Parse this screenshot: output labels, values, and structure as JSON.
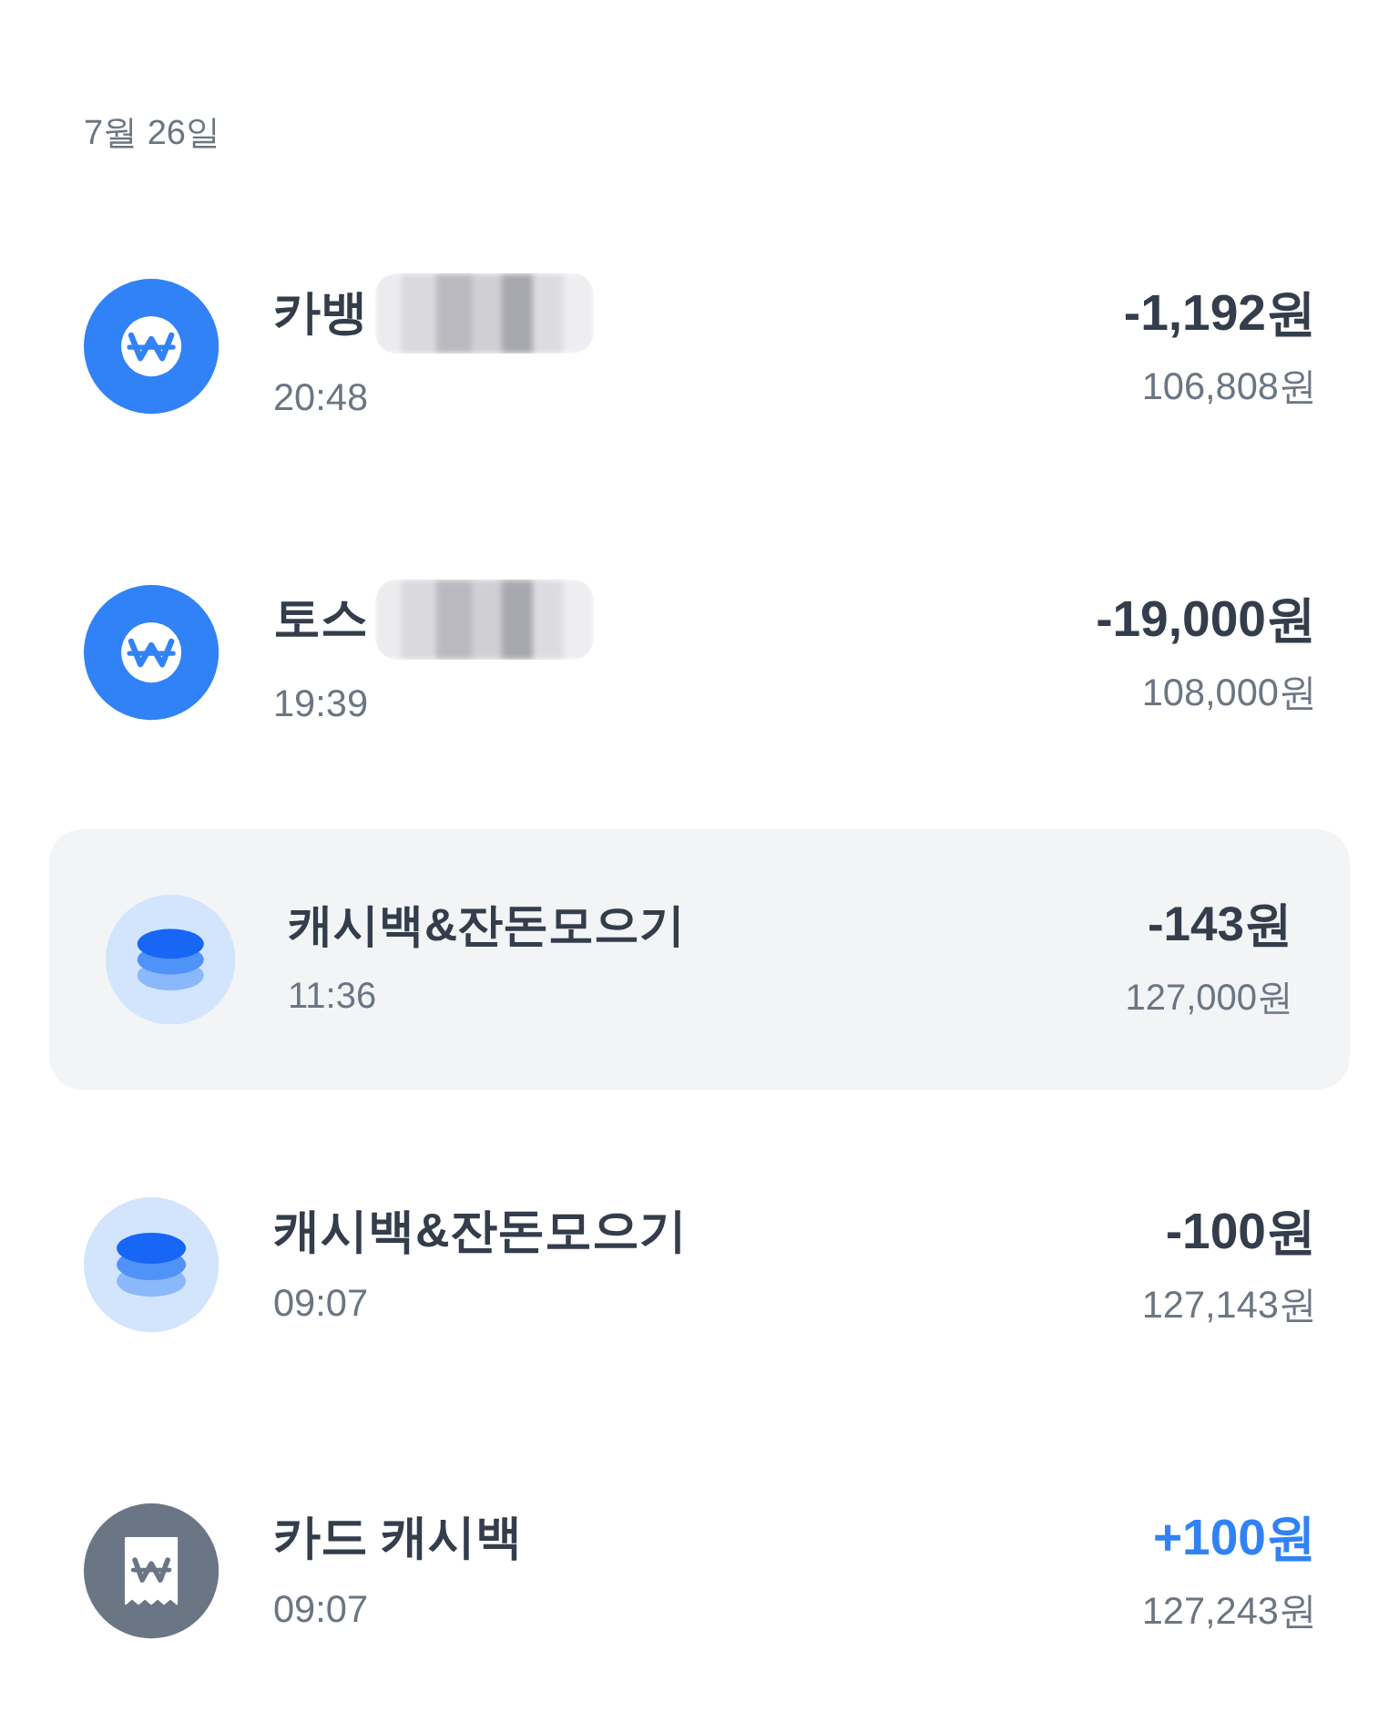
{
  "date_header": "7월 26일",
  "transactions": [
    {
      "kind": "won",
      "title": "카뱅",
      "redacted": true,
      "time": "20:48",
      "amount": "-1,192원",
      "deposit": false,
      "balance": "106,808원",
      "selected": false
    },
    {
      "kind": "won",
      "title": "토스",
      "redacted": true,
      "time": "19:39",
      "amount": "-19,000원",
      "deposit": false,
      "balance": "108,000원",
      "selected": false
    },
    {
      "kind": "coins",
      "title": "캐시백&잔돈모으기",
      "redacted": false,
      "time": "11:36",
      "amount": "-143원",
      "deposit": false,
      "balance": "127,000원",
      "selected": true
    },
    {
      "kind": "coins",
      "title": "캐시백&잔돈모으기",
      "redacted": false,
      "time": "09:07",
      "amount": "-100원",
      "deposit": false,
      "balance": "127,143원",
      "selected": false
    },
    {
      "kind": "receipt",
      "title": "카드 캐시백",
      "redacted": false,
      "time": "09:07",
      "amount": "+100원",
      "deposit": true,
      "balance": "127,243원",
      "selected": false
    }
  ]
}
